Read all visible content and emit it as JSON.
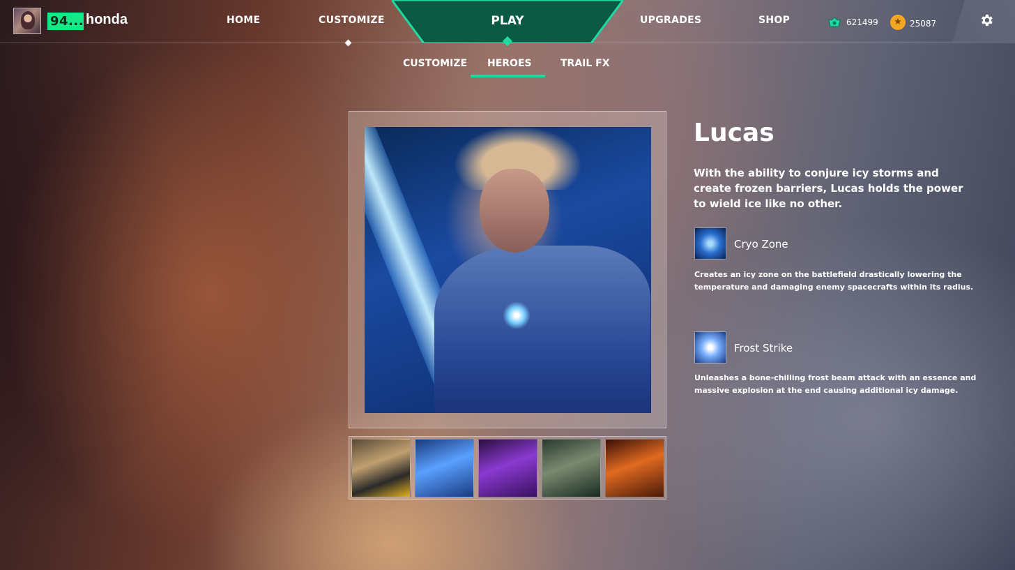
{
  "player": {
    "level": "94...",
    "username": "honda"
  },
  "nav": {
    "home": "HOME",
    "customize": "CUSTOMIZE",
    "play": "PLAY",
    "upgrades": "UPGRADES",
    "shop": "SHOP"
  },
  "currency": {
    "gems": "621499",
    "coins": "25087",
    "gem_icon": "gem-icon",
    "coin_icon": "coin-icon"
  },
  "subtabs": {
    "customize": "CUSTOMIZE",
    "heroes": "HEROES",
    "trail": "TRAIL FX",
    "active": "HEROES"
  },
  "hero": {
    "name": "Lucas",
    "description": "With the ability to conjure icy storms and create frozen barriers, Lucas holds the power to wield ice like no other.",
    "abilities": [
      {
        "name": "Cryo Zone",
        "description": "Creates an icy zone on the battlefield drastically lowering the temperature and damaging enemy spacecrafts within its radius."
      },
      {
        "name": "Frost Strike",
        "description": "Unleashes a bone-chilling frost beam attack with an essence and massive explosion at the end causing additional icy damage."
      }
    ]
  },
  "colors": {
    "accent": "#1fd9a0",
    "level_badge": "#17e887",
    "play_tab": "#0c5a44",
    "coin": "#f5a623"
  }
}
